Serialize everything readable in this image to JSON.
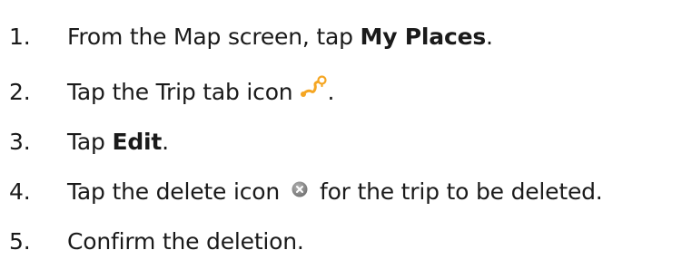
{
  "steps": [
    {
      "number": "1.",
      "pre": "From the Map screen, tap ",
      "bold": "My Places",
      "post": "."
    },
    {
      "number": "2.",
      "pre": "Tap the Trip tab icon",
      "icon": "trip-route-icon",
      "post": "."
    },
    {
      "number": "3.",
      "pre": "Tap ",
      "bold": "Edit",
      "post": "."
    },
    {
      "number": "4.",
      "pre": "Tap the delete icon",
      "icon": "delete-circle-icon",
      "post": "for the trip to be deleted."
    },
    {
      "number": "5.",
      "pre": "Confirm the deletion."
    }
  ],
  "colors": {
    "text": "#1a1a1a",
    "trip_icon": "#f5a623",
    "delete_icon": "#8c8c8c"
  }
}
